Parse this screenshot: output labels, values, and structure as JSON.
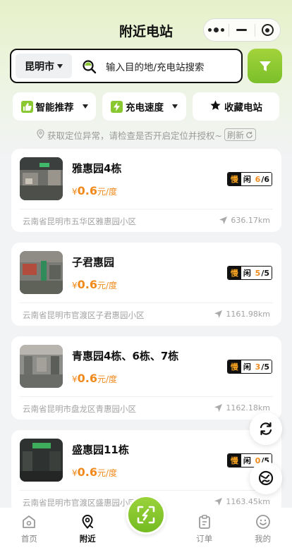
{
  "header": {
    "title": "附近电站"
  },
  "search": {
    "city": "昆明市",
    "placeholder": "输入目的地/充电站搜索"
  },
  "chips": [
    {
      "label": "智能推荐",
      "icon": "thumbs-up-icon"
    },
    {
      "label": "充电速度",
      "icon": "lightning-icon"
    },
    {
      "label": "收藏电站",
      "icon": "star-icon"
    }
  ],
  "notice": {
    "text": "获取定位异常，请检查是否开启定位并授权~",
    "refresh": "刷新"
  },
  "stations": [
    {
      "name": "雅惠园4栋",
      "price_symbol": "¥",
      "price": "0.6",
      "unit": "元/度",
      "slow": "慢",
      "free": "闲",
      "free_count": "6",
      "total": "/6",
      "address": "云南省昆明市五华区雅惠园小区",
      "distance": "636.17km"
    },
    {
      "name": "子君惠园",
      "price_symbol": "¥",
      "price": "0.6",
      "unit": "元/度",
      "slow": "慢",
      "free": "闲",
      "free_count": "5",
      "total": "/5",
      "address": "云南省昆明市官渡区子君惠园小区",
      "distance": "1161.98km"
    },
    {
      "name": "青惠园4栋、6栋、7栋",
      "price_symbol": "¥",
      "price": "0.6",
      "unit": "元/度",
      "slow": "慢",
      "free": "闲",
      "free_count": "3",
      "total": "/5",
      "address": "云南省昆明市盘龙区青惠园小区",
      "distance": "1162.18km"
    },
    {
      "name": "盛惠园11栋",
      "price_symbol": "¥",
      "price": "0.6",
      "unit": "元/度",
      "slow": "慢",
      "free": "闲",
      "free_count": "0",
      "total": "/5",
      "address": "云南省昆明市官渡区盛惠园小区",
      "distance": "1163.45km"
    }
  ],
  "tabbar": [
    {
      "label": "首页"
    },
    {
      "label": "附近"
    },
    {
      "label": ""
    },
    {
      "label": "订单"
    },
    {
      "label": "我的"
    }
  ],
  "colors": {
    "accent": "#8ac832",
    "price": "#f08a1c"
  }
}
